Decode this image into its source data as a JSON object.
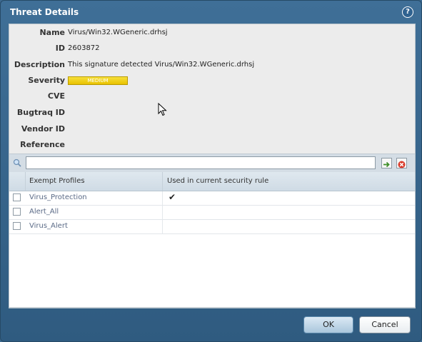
{
  "dialog": {
    "title": "Threat Details",
    "help_label": "?"
  },
  "details": [
    {
      "label": "Name",
      "value": "Virus/Win32.WGeneric.drhsj"
    },
    {
      "label": "ID",
      "value": "2603872"
    },
    {
      "label": "Description",
      "value": "This signature detected Virus/Win32.WGeneric.drhsj"
    },
    {
      "label": "Severity",
      "value": "MEDIUM"
    },
    {
      "label": "CVE",
      "value": ""
    },
    {
      "label": "Bugtraq ID",
      "value": ""
    },
    {
      "label": "Vendor ID",
      "value": ""
    },
    {
      "label": "Reference",
      "value": ""
    }
  ],
  "colors": {
    "severity_medium": "#f2d31b",
    "title_bar": "#3f6f97"
  },
  "search": {
    "value": "",
    "placeholder": ""
  },
  "grid": {
    "columns": [
      "Exempt Profiles",
      "Used in current security rule"
    ],
    "rows": [
      {
        "name": "Virus_Protection",
        "used": "✔",
        "checked": false
      },
      {
        "name": "Alert_All",
        "used": "",
        "checked": false
      },
      {
        "name": "Virus_Alert",
        "used": "",
        "checked": false
      }
    ]
  },
  "buttons": {
    "ok": "OK",
    "cancel": "Cancel"
  }
}
